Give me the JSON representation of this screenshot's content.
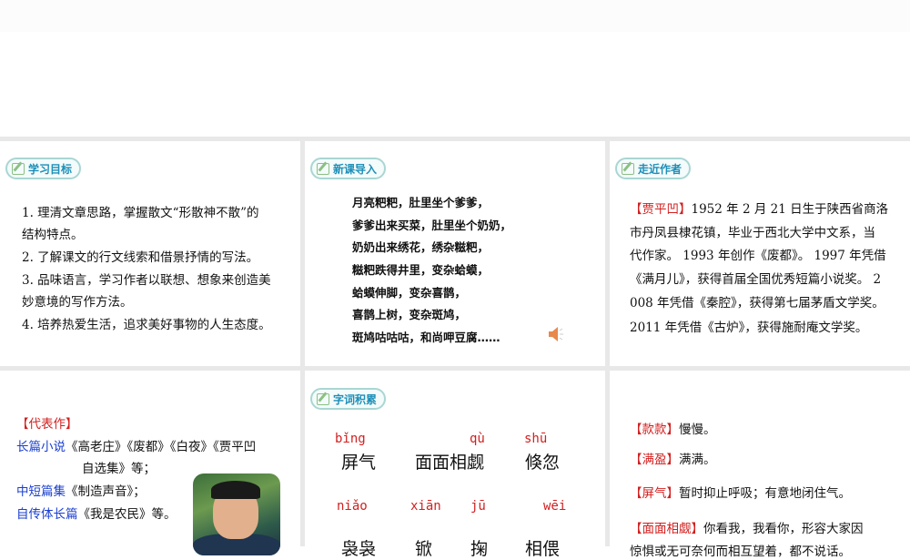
{
  "panels": {
    "objectives": {
      "title": "学习目标",
      "items": [
        "1. 理清文章思路，掌握散文“形散神不散”的",
        "结构特点。",
        "2. 了解课文的行文线索和借景抒情的写法。",
        "3. 品味语言，学习作者以联想、想象来创造美",
        "妙意境的写作方法。",
        "4. 培养热爱生活，追求美好事物的人生态度。"
      ]
    },
    "intro": {
      "title": "新课导入",
      "poem": [
        "月亮粑粑，肚里坐个爹爹，",
        "爹爹出来买菜，肚里坐个奶奶，",
        "奶奶出来绣花，绣杂糍粑，",
        "糍粑跌得井里，变杂蛤蟆，",
        "蛤蟆伸脚，变杂喜鹊，",
        "喜鹊上树，变杂斑鸠，",
        "斑鸠咕咕咕，和尚呷豆腐……"
      ],
      "audio_icon": "speaker-icon"
    },
    "author": {
      "title": "走近作者",
      "name": "【贾平凹】",
      "lines": [
        "1952 年 2 月 21 日生于陕西省商洛",
        "市丹凤县棣花镇，毕业于西北大学中文系，当",
        "代作家。 1993 年创作《废都》。 1997 年凭借",
        "《满月儿》，获得首届全国优秀短篇小说奖。 2",
        "008 年凭借《秦腔》，获得第七届茅盾文学奖。",
        "2011 年凭借《古炉》，获得施耐庵文学奖。"
      ]
    },
    "works": {
      "heading": "【代表作】",
      "rows": [
        {
          "label": "长篇小说",
          "text": "《高老庄》《废都》《白夜》《贾平凹"
        },
        {
          "label": "",
          "text": "自选集》等；"
        },
        {
          "label": "中短篇集",
          "text": "《制造声音》；"
        },
        {
          "label": "自传体长篇",
          "text": "《我是农民》等。"
        }
      ]
    },
    "vocab": {
      "title": "字词积累",
      "row1": [
        {
          "py": "bǐng",
          "word": "屏气"
        },
        {
          "py": "",
          "word": "面面相觑",
          "py2": "qù"
        },
        {
          "py": "shū",
          "word": "倏忽"
        }
      ],
      "row2": [
        {
          "py": "niǎo",
          "word": "袅袅"
        },
        {
          "py": "xiān",
          "word": "锨"
        },
        {
          "py": "jū",
          "word": "掬"
        },
        {
          "py": "wēi",
          "word": "相偎"
        }
      ]
    },
    "definitions": [
      {
        "term": "【款款】",
        "def": "慢慢。"
      },
      {
        "term": "【满盈】",
        "def": "满满。"
      },
      {
        "term": "【屏气】",
        "def": "暂时抑止呼吸；有意地闭住气。"
      },
      {
        "term": "【面面相觑】",
        "def": "你看我，我看你，形容大家因",
        "cont": "惊惧或无可奈何而相互望着，都不说话。"
      }
    ]
  },
  "colors": {
    "accent": "#1d8fb8",
    "red": "#d21f1f",
    "blue": "#1a3fcf"
  }
}
